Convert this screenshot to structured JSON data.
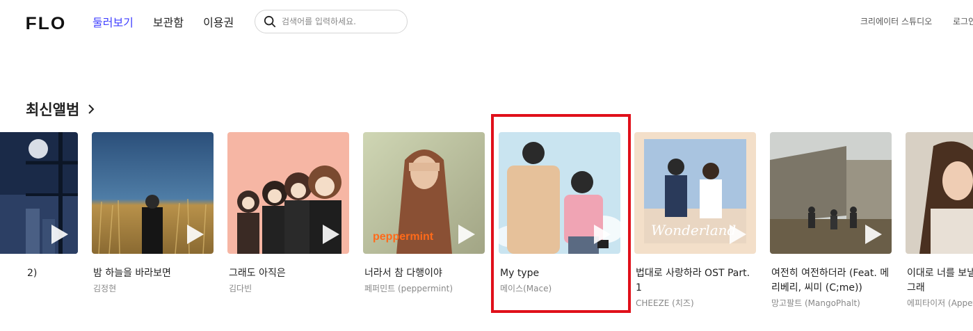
{
  "header": {
    "logo": "FLO",
    "nav": [
      "둘러보기",
      "보관함",
      "이용권"
    ],
    "search_placeholder": "검색어를 입력하세요.",
    "right_links": [
      "크리에이터 스튜디오",
      "로그인"
    ]
  },
  "section": {
    "title": "최신앨범"
  },
  "albums": [
    {
      "title": "2)",
      "artist": ""
    },
    {
      "title": "밤 하늘을 바라보면",
      "artist": "김정현"
    },
    {
      "title": "그래도 아직은",
      "artist": "김다빈"
    },
    {
      "title": "너라서 참 다행이야",
      "artist": "페퍼민트 (peppermint)"
    },
    {
      "title": "My type",
      "artist": "메이스(Mace)"
    },
    {
      "title": "법대로 사랑하라 OST Part. 1",
      "artist": "CHEEZE (치즈)"
    },
    {
      "title": "여전히 여전하더라 (Feat. 메리베리, 씨미 (C;me))",
      "artist": "망고팔트 (MangoPhalt)"
    },
    {
      "title": "이대로 너를 보낼 수 없어서 그래",
      "artist": "에피타이저 (Appetizer)"
    }
  ],
  "cover_text": {
    "peppermint": "peppermint",
    "wonderland": "Wonderland"
  },
  "colors": {
    "accent": "#3f3fff",
    "highlight": "#e0101a"
  }
}
